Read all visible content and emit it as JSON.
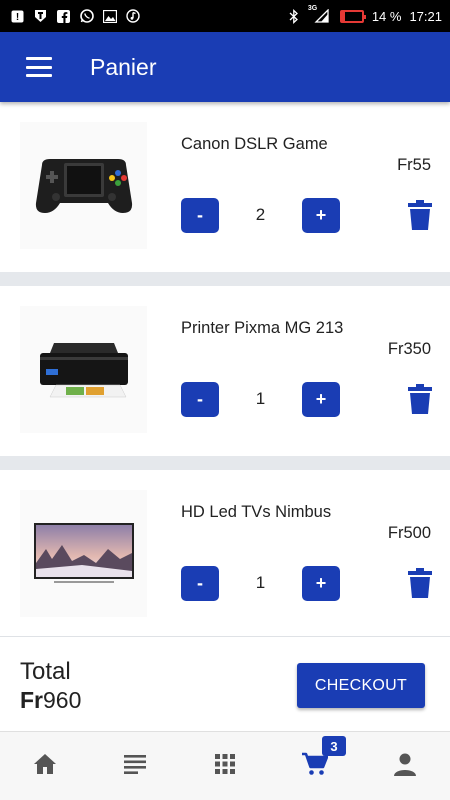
{
  "status_bar": {
    "battery": "14 %",
    "battery_level": 0.14,
    "time": "17:21",
    "network": "3G",
    "icons_left": [
      "notification-icon",
      "vpn-icon",
      "facebook-icon",
      "whatsapp-icon",
      "gallery-icon",
      "music-icon"
    ],
    "icons_right": [
      "bluetooth-icon",
      "signal-icon",
      "battery-icon"
    ]
  },
  "app_bar": {
    "title": "Panier"
  },
  "cart": {
    "items": [
      {
        "name": "Canon DSLR Game",
        "price": "Fr55",
        "quantity": "2",
        "image": "gamepad-image"
      },
      {
        "name": "Printer Pixma MG 213",
        "price": "Fr350",
        "quantity": "1",
        "image": "printer-image"
      },
      {
        "name": "HD Led TVs Nimbus",
        "price": "Fr500",
        "quantity": "1",
        "image": "tv-image"
      }
    ],
    "decrement_label": "-",
    "increment_label": "+"
  },
  "total": {
    "label": "Total",
    "currency": "Fr",
    "amount": "960",
    "checkout_label": "CHECKOUT"
  },
  "bottom_nav": {
    "items": [
      "home-icon",
      "list-icon",
      "grid-icon",
      "cart-icon",
      "profile-icon"
    ],
    "cart_badge": "3",
    "active": "cart-icon"
  },
  "colors": {
    "primary": "#1a3db4",
    "divider": "#e5e8ec",
    "battery_low": "#e53935"
  }
}
